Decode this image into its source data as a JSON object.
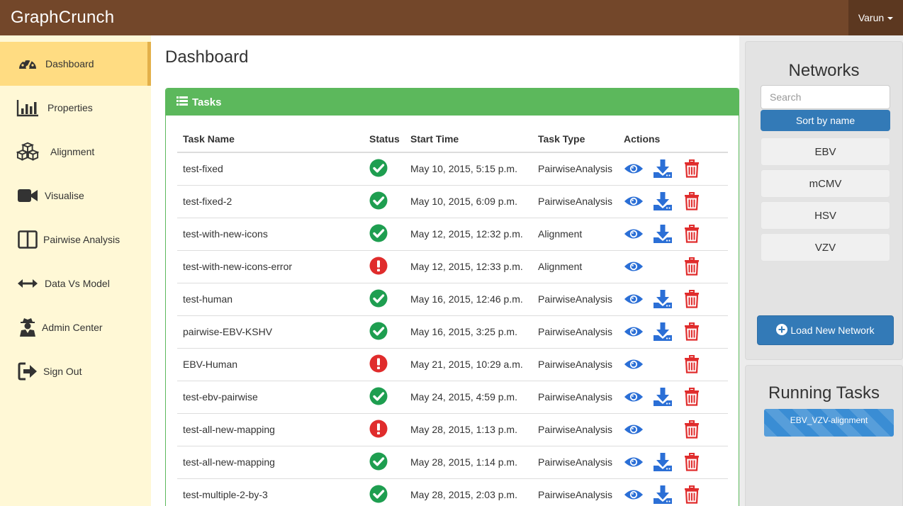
{
  "navbar": {
    "brand": "GraphCrunch",
    "user": "Varun"
  },
  "sidebar": {
    "items": [
      {
        "label": "Dashboard",
        "icon": "dashboard-icon",
        "active": true
      },
      {
        "label": "Properties",
        "icon": "bar-chart-icon"
      },
      {
        "label": "Alignment",
        "icon": "cubes-icon"
      },
      {
        "label": "Visualise",
        "icon": "video-camera-icon"
      },
      {
        "label": "Pairwise Analysis",
        "icon": "columns-icon"
      },
      {
        "label": "Data Vs Model",
        "icon": "arrows-horizontal-icon"
      },
      {
        "label": "Admin Center",
        "icon": "user-secret-icon"
      },
      {
        "label": "Sign Out",
        "icon": "sign-out-icon"
      }
    ]
  },
  "main": {
    "title": "Dashboard",
    "panel_title": "Tasks",
    "columns": [
      "Task Name",
      "Status",
      "Start Time",
      "Task Type",
      "Actions"
    ],
    "tasks": [
      {
        "name": "test-fixed",
        "status": "success",
        "start": "May 10, 2015, 5:15 p.m.",
        "type": "PairwiseAnalysis",
        "download": true
      },
      {
        "name": "test-fixed-2",
        "status": "success",
        "start": "May 10, 2015, 6:09 p.m.",
        "type": "PairwiseAnalysis",
        "download": true
      },
      {
        "name": "test-with-new-icons",
        "status": "success",
        "start": "May 12, 2015, 12:32 p.m.",
        "type": "Alignment",
        "download": true
      },
      {
        "name": "test-with-new-icons-error",
        "status": "error",
        "start": "May 12, 2015, 12:33 p.m.",
        "type": "Alignment",
        "download": false
      },
      {
        "name": "test-human",
        "status": "success",
        "start": "May 16, 2015, 12:46 p.m.",
        "type": "PairwiseAnalysis",
        "download": true
      },
      {
        "name": "pairwise-EBV-KSHV",
        "status": "success",
        "start": "May 16, 2015, 3:25 p.m.",
        "type": "PairwiseAnalysis",
        "download": true
      },
      {
        "name": "EBV-Human",
        "status": "error",
        "start": "May 21, 2015, 10:29 a.m.",
        "type": "PairwiseAnalysis",
        "download": false
      },
      {
        "name": "test-ebv-pairwise",
        "status": "success",
        "start": "May 24, 2015, 4:59 p.m.",
        "type": "PairwiseAnalysis",
        "download": true
      },
      {
        "name": "test-all-new-mapping",
        "status": "error",
        "start": "May 28, 2015, 1:13 p.m.",
        "type": "PairwiseAnalysis",
        "download": false
      },
      {
        "name": "test-all-new-mapping",
        "status": "success",
        "start": "May 28, 2015, 1:14 p.m.",
        "type": "PairwiseAnalysis",
        "download": true
      },
      {
        "name": "test-multiple-2-by-3",
        "status": "success",
        "start": "May 28, 2015, 2:03 p.m.",
        "type": "PairwiseAnalysis",
        "download": true
      }
    ]
  },
  "networks": {
    "title": "Networks",
    "search_placeholder": "Search",
    "sort_label": "Sort by name",
    "items": [
      "EBV",
      "mCMV",
      "HSV",
      "VZV"
    ],
    "load_label": "Load New Network"
  },
  "running": {
    "title": "Running Tasks",
    "tasks": [
      "EBV_VZV-alignment"
    ]
  },
  "colors": {
    "navbar": "#73472a",
    "sidebar": "#fff8d6",
    "sidebar_active": "#ffdc82",
    "success": "#1e9e50",
    "error": "#e02c2c",
    "primary": "#337ab7",
    "panel_green": "#5cb85c"
  }
}
